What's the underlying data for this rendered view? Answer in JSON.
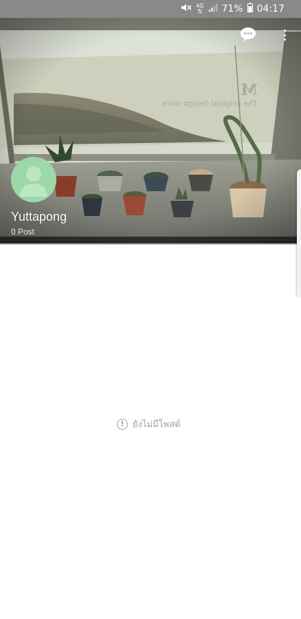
{
  "status_bar": {
    "network": "4G",
    "battery_percent": "71%",
    "time": "04:17"
  },
  "cover": {
    "watermark_letter": "M",
    "watermark_text": "The original design store"
  },
  "profile": {
    "name": "Yuttapong",
    "post_count": "0 Post"
  },
  "empty_state": {
    "message": "ยังไม่มีโพสต์"
  },
  "icons": {
    "mute": "mute-icon",
    "signal": "signal-icon",
    "battery": "battery-icon",
    "chat": "chat-bubble-icon",
    "more": "more-vertical-icon",
    "avatar": "default-avatar-icon",
    "warning": "exclamation-circle-icon"
  }
}
